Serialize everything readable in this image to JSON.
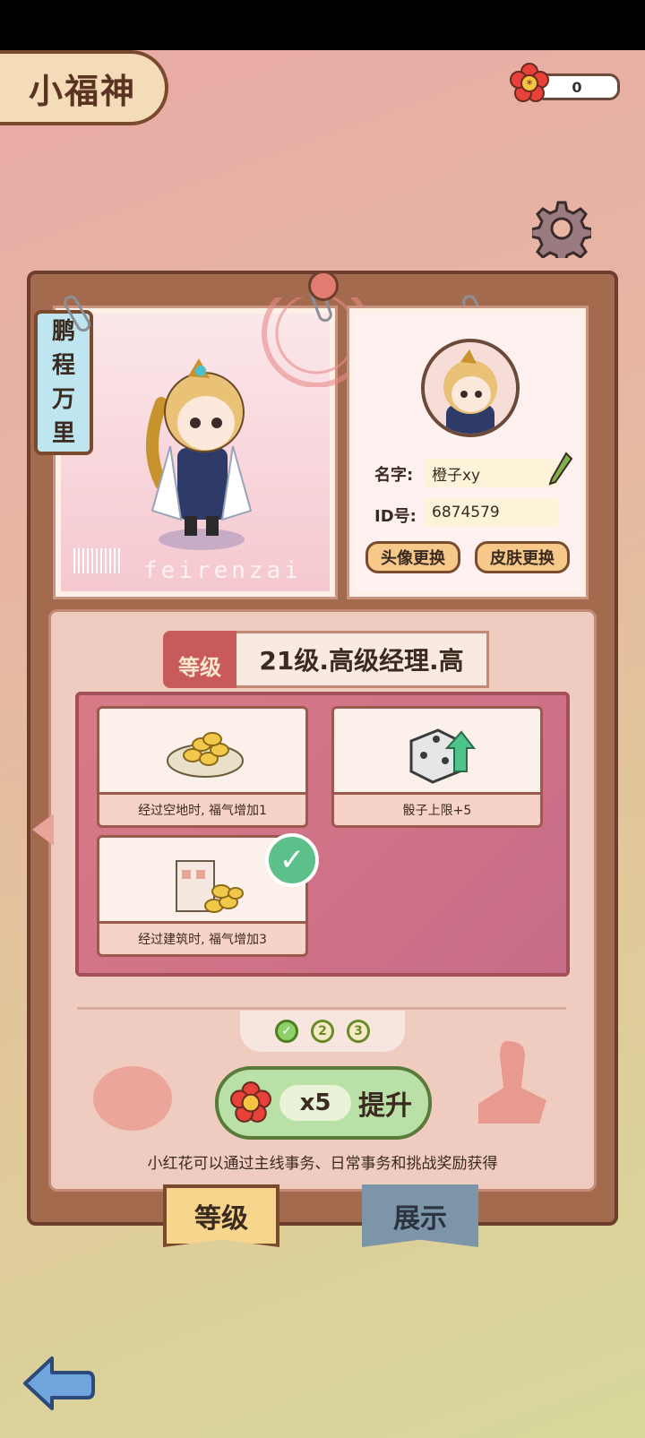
{
  "header": {
    "title": "小福神"
  },
  "currency": {
    "icon": "red-flower-icon",
    "value": "0"
  },
  "profile": {
    "vertical_title": [
      "鹏",
      "程",
      "万",
      "里"
    ],
    "watermark": "feirenzai",
    "name_label": "名字:",
    "name_value": "橙子xy",
    "id_label": "ID号:",
    "id_value": "6874579",
    "avatar_change_label": "头像更换",
    "skin_change_label": "皮肤更换"
  },
  "level": {
    "tag": "等级",
    "title": "21级.高级经理.高"
  },
  "perks": [
    {
      "caption": "经过空地时, 福气增加1",
      "icon": "coins-plate-icon",
      "checked": false
    },
    {
      "caption": "骰子上限+5",
      "icon": "dice-up-icon",
      "checked": false
    },
    {
      "caption": "经过建筑时, 福气增加3",
      "icon": "building-coins-icon",
      "checked": true
    }
  ],
  "pager": [
    "2",
    "3"
  ],
  "upgrade": {
    "count": "x5",
    "label": "提升"
  },
  "hint": "小红花可以通过主线事务、日常事务和挑战奖励获得",
  "tabs": {
    "level": "等级",
    "show": "展示"
  },
  "colors": {
    "accent_red": "#c85b59",
    "board_brown": "#a46a4e",
    "green": "#5cc08a"
  }
}
